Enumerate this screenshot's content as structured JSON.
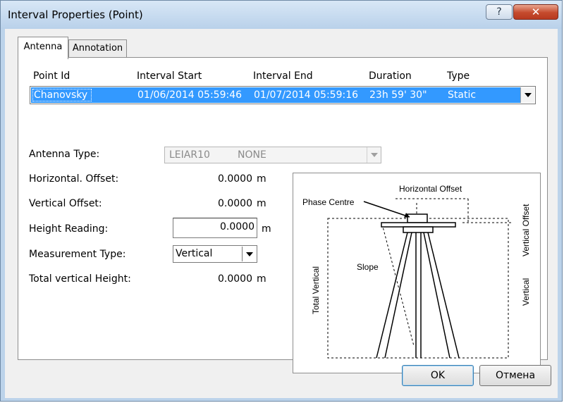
{
  "window": {
    "title": "Interval Properties (Point)"
  },
  "titlebar": {
    "help_label": "?",
    "close_label": "✕"
  },
  "tabs": [
    {
      "label": "Antenna"
    },
    {
      "label": "Annotation"
    }
  ],
  "interval_table": {
    "columns": [
      "Point Id",
      "Interval Start",
      "Interval End",
      "Duration",
      "Type"
    ],
    "selected_row": [
      "Chanovsky",
      "01/06/2014 05:59:46",
      "01/07/2014 05:59:16",
      "23h 59' 30\"",
      "Static"
    ]
  },
  "antenna": {
    "type_label": "Antenna Type:",
    "type_value": "LEIAR10",
    "radome_value": "NONE",
    "horizontal_offset_label": "Horizontal. Offset:",
    "horizontal_offset_value": "0.0000",
    "vertical_offset_label": "Vertical Offset:",
    "vertical_offset_value": "0.0000",
    "height_reading_label": "Height Reading:",
    "height_reading_value": "0.0000",
    "measurement_type_label": "Measurement Type:",
    "measurement_type_value": "Vertical",
    "total_vertical_height_label": "Total vertical Height:",
    "total_vertical_height_value": "0.0000",
    "unit": "m"
  },
  "diagram": {
    "phase_centre": "Phase Centre",
    "horizontal_offset": "Horizontal Offset",
    "vertical_offset": "Vertical Offset",
    "slope": "Slope",
    "total_vertical": "Total Vertical",
    "vertical": "Vertical"
  },
  "buttons": {
    "ok": "OK",
    "cancel": "Отмена"
  }
}
